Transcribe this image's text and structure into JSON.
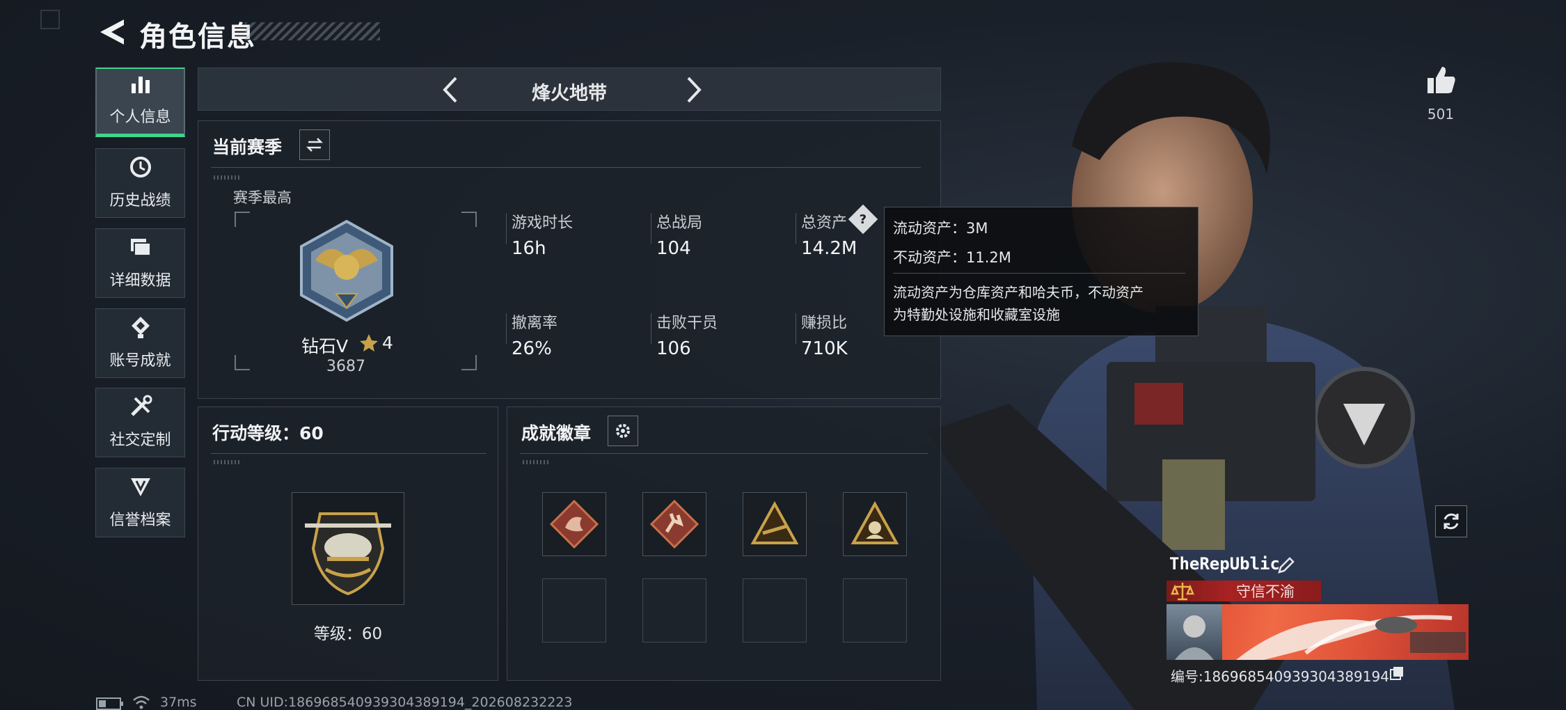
{
  "header": {
    "title": "角色信息"
  },
  "sidebar": {
    "items": [
      {
        "label": "个人信息",
        "icon": "bar-chart-icon",
        "active": true
      },
      {
        "label": "历史战绩",
        "icon": "history-icon"
      },
      {
        "label": "详细数据",
        "icon": "folder-icon"
      },
      {
        "label": "账号成就",
        "icon": "achievement-icon"
      },
      {
        "label": "社交定制",
        "icon": "tools-icon"
      },
      {
        "label": "信誉档案",
        "icon": "shield-icon"
      }
    ]
  },
  "mode": {
    "label": "烽火地带"
  },
  "season": {
    "title": "当前赛季",
    "best_label": "赛季最高",
    "rank_name": "钻石V",
    "rank_stars": "4",
    "rank_score": "3687",
    "stats": [
      {
        "label": "游戏时长",
        "value": "16h"
      },
      {
        "label": "总战局",
        "value": "104"
      },
      {
        "label": "总资产",
        "value": "14.2M"
      },
      {
        "label": "撤离率",
        "value": "26%"
      },
      {
        "label": "击败干员",
        "value": "106"
      },
      {
        "label": "赚损比",
        "value": "710K"
      }
    ]
  },
  "tooltip": {
    "liquid": "流动资产：3M",
    "fixed": "不动资产：11.2M",
    "desc_line1": "流动资产为仓库资产和哈夫币，不动资产",
    "desc_line2": "为特勤处设施和收藏室设施"
  },
  "action_level": {
    "title": "行动等级：60",
    "level_text": "等级：60"
  },
  "badges": {
    "title": "成就徽章",
    "filled": 4,
    "empty": 4
  },
  "likes": {
    "count": "501"
  },
  "player": {
    "name": "TheRepUblic",
    "title": "守信不渝",
    "id_number": "编号:1869685409393043891​94"
  },
  "status": {
    "ping": "37ms",
    "uid": "CN UID:186968540939304389194_202608232223"
  },
  "colors": {
    "accent_green": "#3fd68a",
    "title_red": "#a82222",
    "gold": "#c8a24a"
  }
}
